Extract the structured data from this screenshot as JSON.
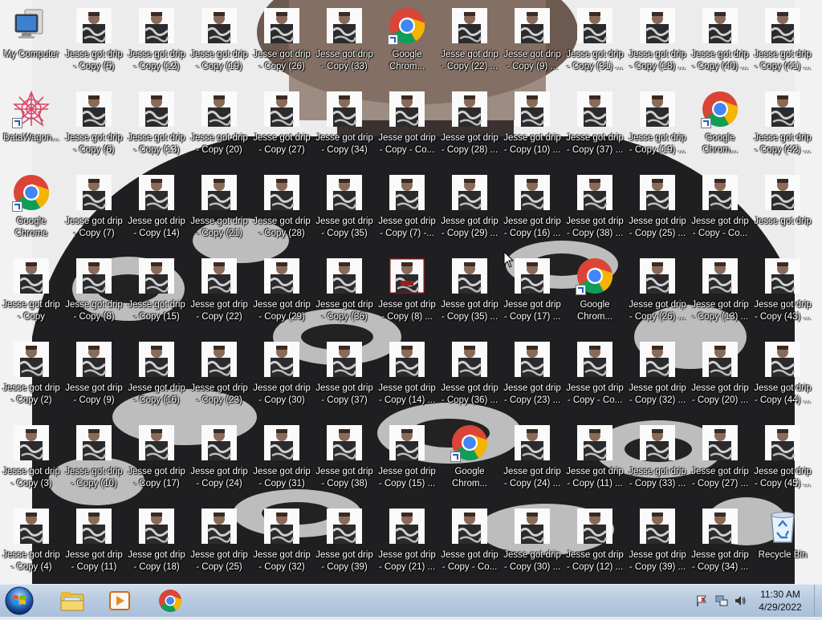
{
  "desktop": {
    "columns": [
      [
        "My Computer",
        "DataWagon...",
        "Google\nChrome",
        "Jesse got drip\n- Copy",
        "Jesse got drip\n- Copy (2)",
        "Jesse got drip\n- Copy (3)",
        "Jesse got drip\n- Copy (4)"
      ],
      [
        "Jesse got drip\n- Copy (5)",
        "Jesse got drip\n- Copy (6)",
        "Jesse got drip\n- Copy (7)",
        "Jesse got drip\n- Copy (8)",
        "Jesse got drip\n- Copy (9)",
        "Jesse got drip\n- Copy (10)",
        "Jesse got drip\n- Copy (11)"
      ],
      [
        "Jesse got drip\n- Copy (12)",
        "Jesse got drip\n- Copy (13)",
        "Jesse got drip\n- Copy (14)",
        "Jesse got drip\n- Copy (15)",
        "Jesse got drip\n- Copy (16)",
        "Jesse got drip\n- Copy (17)",
        "Jesse got drip\n- Copy (18)"
      ],
      [
        "Jesse got drip\n- Copy (19)",
        "Jesse got drip\n- Copy (20)",
        "Jesse got drip\n- Copy (21)",
        "Jesse got drip\n- Copy (22)",
        "Jesse got drip\n- Copy (23)",
        "Jesse got drip\n- Copy (24)",
        "Jesse got drip\n- Copy (25)"
      ],
      [
        "Jesse got drip\n- Copy (26)",
        "Jesse got drip\n- Copy (27)",
        "Jesse got drip\n- Copy (28)",
        "Jesse got drip\n- Copy (29)",
        "Jesse got drip\n- Copy (30)",
        "Jesse got drip\n- Copy (31)",
        "Jesse got drip\n- Copy (32)"
      ],
      [
        "Jesse got drip\n- Copy (33)",
        "Jesse got drip\n- Copy (34)",
        "Jesse got drip\n- Copy (35)",
        "Jesse got drip\n- Copy (36)",
        "Jesse got drip\n- Copy (37)",
        "Jesse got drip\n- Copy (38)",
        "Jesse got drip\n- Copy (39)"
      ],
      [
        "Google\nChrom...",
        "Jesse got drip\n- Copy - Co...",
        "Jesse got drip\n- Copy (7) -...",
        "Jesse got drip\n- Copy (8) ...",
        "Jesse got drip\n- Copy (14) ...",
        "Jesse got drip\n- Copy (15) ...",
        "Jesse got drip\n- Copy (21) ..."
      ],
      [
        "Jesse got drip\n- Copy (22) ...",
        "Jesse got drip\n- Copy (28) ...",
        "Jesse got drip\n- Copy (29) ...",
        "Jesse got drip\n- Copy (35) ...",
        "Jesse got drip\n- Copy (36) ...",
        "Google\nChrom...",
        "Jesse got drip\n- Copy - Co..."
      ],
      [
        "Jesse got drip\n- Copy (9) ...",
        "Jesse got drip\n- Copy (10) ...",
        "Jesse got drip\n- Copy (16) ...",
        "Jesse got drip\n- Copy (17) ...",
        "Jesse got drip\n- Copy (23) ...",
        "Jesse got drip\n- Copy (24) ...",
        "Jesse got drip\n- Copy (30) ..."
      ],
      [
        "Jesse got drip\n- Copy (31) ...",
        "Jesse got drip\n- Copy (37) ...",
        "Jesse got drip\n- Copy (38) ...",
        "Google\nChrom...",
        "Jesse got drip\n- Copy - Co...",
        "Jesse got drip\n- Copy (11) ...",
        "Jesse got drip\n- Copy (12) ..."
      ],
      [
        "Jesse got drip\n- Copy (18) ...",
        "Jesse got drip\n- Copy (19) ...",
        "Jesse got drip\n- Copy (25) ...",
        "Jesse got drip\n- Copy (26) ...",
        "Jesse got drip\n- Copy (32) ...",
        "Jesse got drip\n- Copy (33) ...",
        "Jesse got drip\n- Copy (39) ..."
      ],
      [
        "Jesse got drip\n- Copy (40) ...",
        "Google\nChrom...",
        "Jesse got drip\n- Copy - Co...",
        "Jesse got drip\n- Copy (13) ...",
        "Jesse got drip\n- Copy (20) ...",
        "Jesse got drip\n- Copy (27) ...",
        "Jesse got drip\n- Copy (34) ..."
      ],
      [
        "Jesse got drip\n- Copy (41) ...",
        "Jesse got drip\n- Copy (42) ...",
        "Jesse got drip",
        "Jesse got drip\n- Copy (43) ...",
        "Jesse got drip\n- Copy (44) ...",
        "Jesse got drip\n- Copy (45) ...",
        "Recycle Bin"
      ]
    ],
    "icon_kinds": [
      [
        "computer",
        "datawagon",
        "chrome",
        "photo",
        "photo",
        "photo",
        "photo"
      ],
      [
        "photo",
        "photo",
        "photo",
        "photo",
        "photo",
        "photo",
        "photo"
      ],
      [
        "photo",
        "photo",
        "photo",
        "photo",
        "photo",
        "photo",
        "photo"
      ],
      [
        "photo",
        "photo",
        "photo",
        "photo",
        "photo",
        "photo",
        "photo"
      ],
      [
        "photo",
        "photo",
        "photo",
        "photo",
        "photo",
        "photo",
        "photo"
      ],
      [
        "photo",
        "photo",
        "photo",
        "photo",
        "photo",
        "photo",
        "photo"
      ],
      [
        "chrome",
        "photo",
        "photo",
        "photo-alt",
        "photo",
        "photo",
        "photo"
      ],
      [
        "photo",
        "photo",
        "photo",
        "photo",
        "photo",
        "chrome",
        "photo"
      ],
      [
        "photo",
        "photo",
        "photo",
        "photo",
        "photo",
        "photo",
        "photo"
      ],
      [
        "photo",
        "photo",
        "photo",
        "chrome",
        "photo",
        "photo",
        "photo"
      ],
      [
        "photo",
        "photo",
        "photo",
        "photo",
        "photo",
        "photo",
        "photo"
      ],
      [
        "photo",
        "chrome",
        "photo",
        "photo",
        "photo",
        "photo",
        "photo"
      ],
      [
        "photo",
        "photo",
        "photo",
        "photo",
        "photo",
        "photo",
        "recycle-bin"
      ]
    ]
  },
  "taskbar": {
    "start_icon": "windows-start-orb",
    "pinned": [
      {
        "name": "explorer-taskbar-button",
        "icon": "folder-icon"
      },
      {
        "name": "media-player-taskbar-button",
        "icon": "media-player-icon"
      },
      {
        "name": "chrome-taskbar-button",
        "icon": "chrome-icon"
      }
    ],
    "tray_icons": [
      "action-center-flag-icon",
      "network-icon",
      "volume-icon"
    ],
    "clock_time": "11:30 AM",
    "clock_date": "4/29/2022"
  },
  "colors": {
    "taskbar": "#b9cbe0",
    "chrome_red": "#db4437",
    "chrome_green": "#0f9d58",
    "chrome_yellow": "#f4b400",
    "chrome_blue": "#4285f4"
  }
}
